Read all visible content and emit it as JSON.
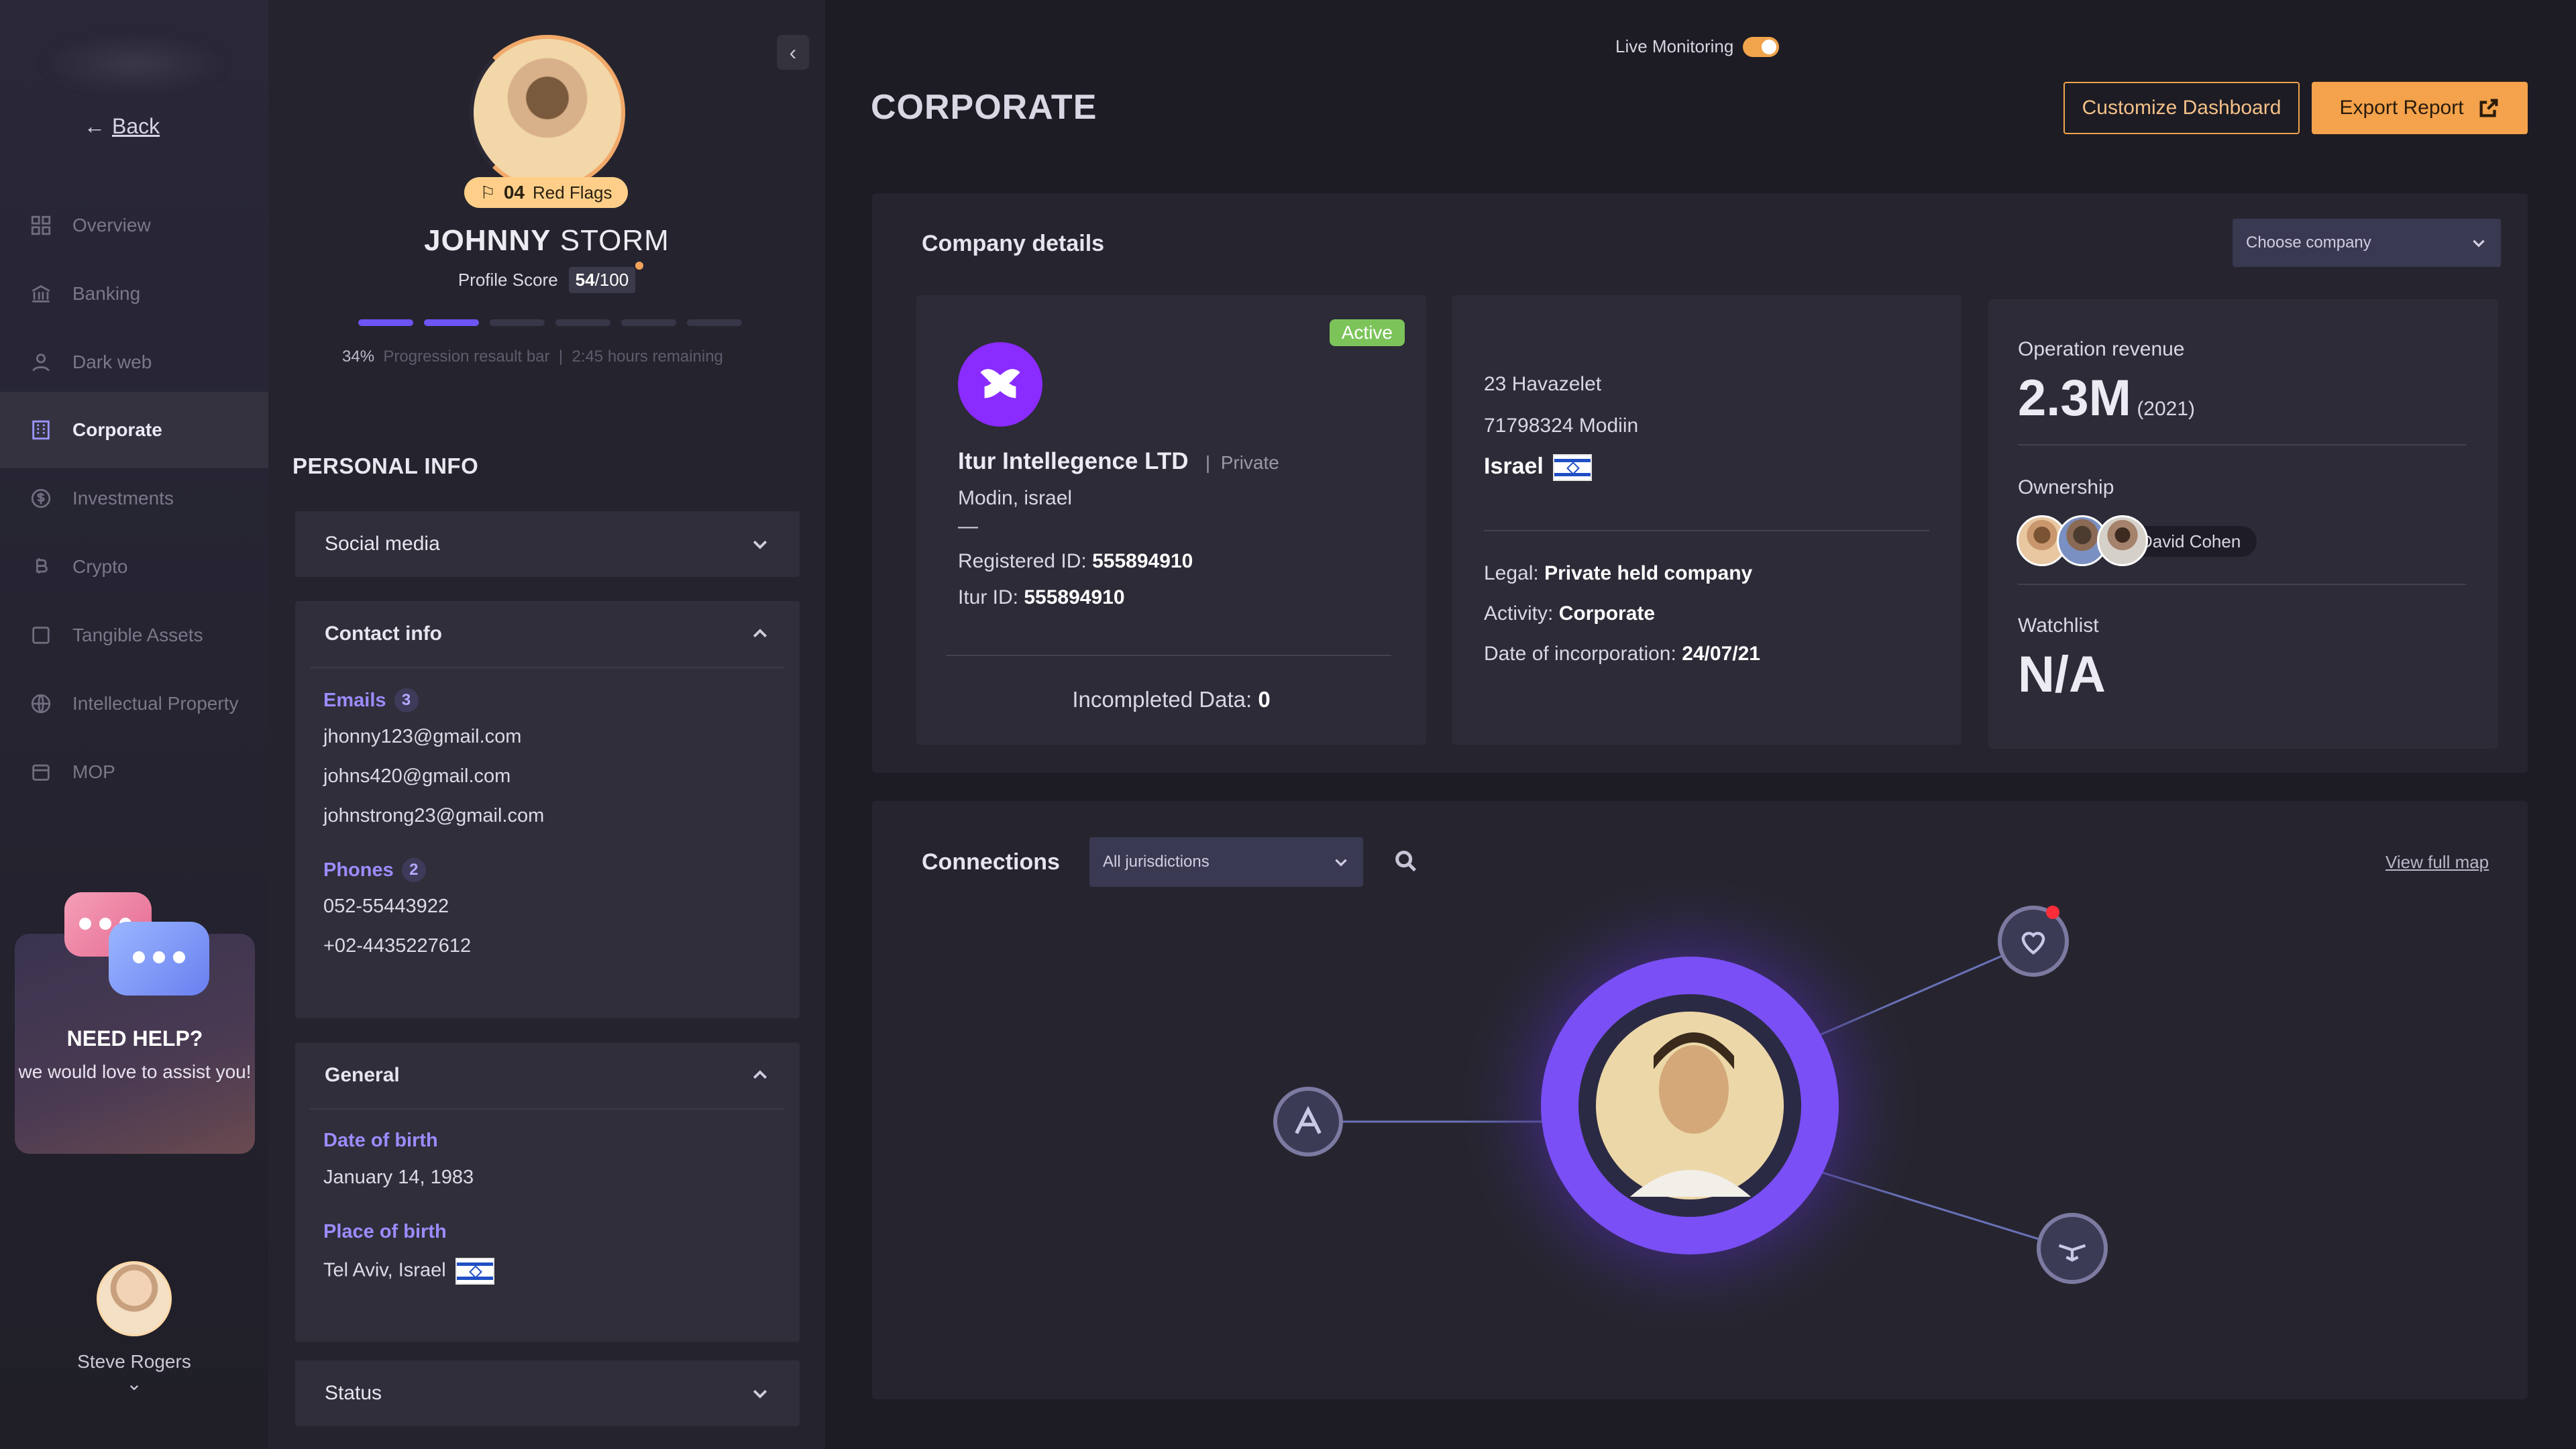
{
  "nav": {
    "back": "Back",
    "items": [
      {
        "label": "Overview",
        "icon": "grid-icon"
      },
      {
        "label": "Banking",
        "icon": "bank-icon"
      },
      {
        "label": "Dark web",
        "icon": "user-icon"
      },
      {
        "label": "Corporate",
        "icon": "building-icon"
      },
      {
        "label": "Investments",
        "icon": "dollar-icon"
      },
      {
        "label": "Crypto",
        "icon": "bitcoin-icon"
      },
      {
        "label": "Tangible Assets",
        "icon": "square-icon"
      },
      {
        "label": "Intellectual Property",
        "icon": "globe-icon"
      },
      {
        "label": "MOP",
        "icon": "calendar-icon"
      }
    ],
    "active": "Corporate",
    "help_title": "NEED HELP?",
    "help_text": "we would love to assist you!",
    "user_name": "Steve Rogers"
  },
  "profile": {
    "red_flags_count": "04",
    "red_flags_label": "Red Flags",
    "first_name": "JOHNNY",
    "last_name": "STORM",
    "score_label": "Profile Score",
    "score_value": "54",
    "score_max": "/100",
    "progress_steps_done": 2,
    "progress_steps_total": 6,
    "progress_percent": "34%",
    "progress_text": "Progression resault bar",
    "progress_sep": "|",
    "progress_remaining": "2:45 hours remaining",
    "section_title": "PERSONAL INFO",
    "social_media": "Social media",
    "contact_info": "Contact info",
    "emails_label": "Emails",
    "emails_count": "3",
    "emails": [
      "jhonny123@gmail.com",
      "johns420@gmail.com",
      "johnstrong23@gmail.com"
    ],
    "phones_label": "Phones",
    "phones_count": "2",
    "phones": [
      "052-55443922",
      "+02-4435227612"
    ],
    "general": "General",
    "dob_label": "Date of birth",
    "dob": "January 14, 1983",
    "pob_label": "Place of birth",
    "pob": "Tel Aviv, Israel",
    "status": "Status"
  },
  "header": {
    "live_monitoring": "Live Monitoring",
    "live_on": true,
    "title": "CORPORATE",
    "customize": "Customize Dashboard",
    "export": "Export Report"
  },
  "company": {
    "panel_title": "Company details",
    "choose": "Choose company",
    "status": "Active",
    "name": "Itur Intellegence LTD",
    "sep": "|",
    "type": "Private",
    "location": "Modin, israel",
    "dash": "—",
    "registered_label": "Registered ID:",
    "registered_id": "555894910",
    "itur_label": "Itur ID:",
    "itur_id": "555894910",
    "incomplete_label": "Incompleted Data:",
    "incomplete_value": "0",
    "address1": "23 Havazelet",
    "address2": "71798324 Modiin",
    "country": "Israel",
    "legal_label": "Legal:",
    "legal": "Private held company",
    "activity_label": "Activity:",
    "activity": "Corporate",
    "incorp_label": "Date of incorporation:",
    "incorp": "24/07/21",
    "revenue_label": "Operation revenue",
    "revenue": "2.3M",
    "revenue_year": "(2021)",
    "ownership_label": "Ownership",
    "owner_name": "David Cohen",
    "watchlist_label": "Watchlist",
    "watchlist": "N/A"
  },
  "connections": {
    "title": "Connections",
    "jurisdiction": "All jurisdictions",
    "view_map": "View full map"
  },
  "colors": {
    "accent": "#f4a24b",
    "purple": "#6d54f5",
    "active": "#7cc45a"
  }
}
